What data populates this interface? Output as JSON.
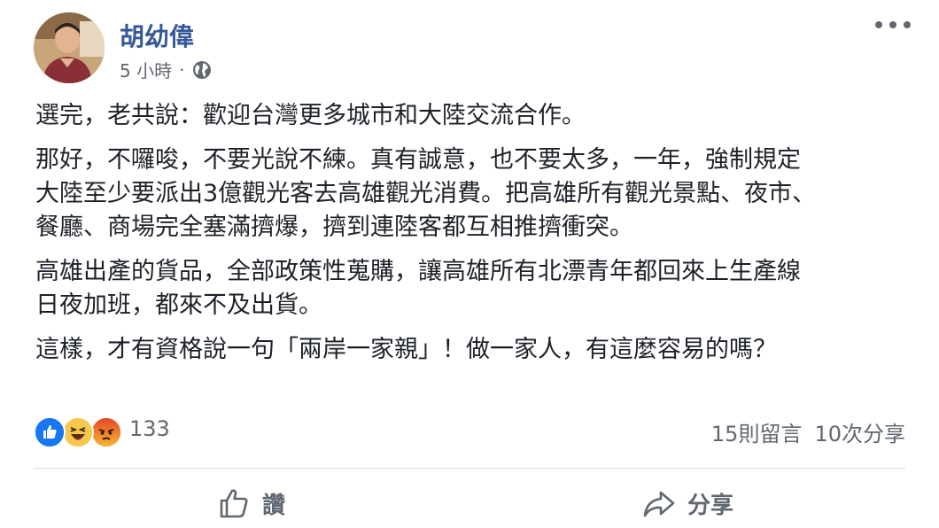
{
  "post": {
    "author": "胡幼偉",
    "time": "5 小時",
    "separator": "·",
    "privacy_icon": "globe-icon",
    "more_icon": "more-horizontal-icon",
    "paragraphs": [
      [
        "選完，老共說：歡迎台灣更多城市和大陸交流合作。"
      ],
      [
        "那好，不囉唆，不要光說不練。真有誠意，也不要太多，一年，強制規定",
        "大陸至少要派出3億觀光客去高雄觀光消費。把高雄所有觀光景點、夜市、",
        "餐廳、商場完全塞滿擠爆，擠到連陸客都互相推擠衝突。"
      ],
      [
        "高雄出產的貨品，全部政策性蒐購，讓高雄所有北漂青年都回來上生產線",
        "日夜加班，都來不及出貨。"
      ],
      [
        "這樣，才有資格說一句「兩岸一家親」！做一家人，有這麼容易的嗎？"
      ]
    ]
  },
  "reactions": {
    "icons": [
      "like-reaction-icon",
      "haha-reaction-icon",
      "angry-reaction-icon"
    ],
    "count": "133",
    "comments": "15則留言",
    "shares": "10次分享"
  },
  "actions": {
    "like_label": "讚",
    "share_label": "分享"
  },
  "colors": {
    "author": "#365899",
    "meta": "#616770",
    "like_blue": "#1877f2",
    "haha_yellow": "#f7c84b",
    "angry_orange": "#e9710f"
  }
}
